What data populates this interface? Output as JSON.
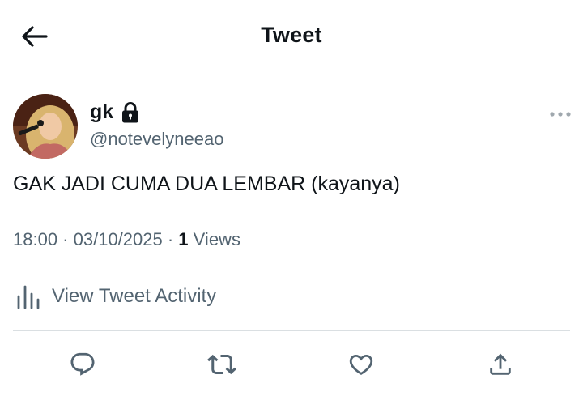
{
  "header": {
    "title": "Tweet",
    "back_icon": "arrow-left-icon"
  },
  "author": {
    "display_name": "gk",
    "handle": "@notevelyneeao",
    "locked_icon": "lock-icon"
  },
  "tweet": {
    "text": "GAK JADI CUMA DUA LEMBAR (kayanya)"
  },
  "meta": {
    "time": "18:00",
    "sep1": " · ",
    "date": "03/10/2025",
    "sep2": " · ",
    "views_count": "1",
    "views_label": " Views"
  },
  "activity": {
    "label": "View Tweet Activity",
    "icon": "bar-chart-icon"
  },
  "actions": [
    "reply-icon",
    "retweet-icon",
    "like-icon",
    "share-icon"
  ],
  "colors": {
    "text_primary": "#0f1419",
    "text_secondary": "#536471",
    "divider": "#dadfe2",
    "background": "#ffffff"
  }
}
